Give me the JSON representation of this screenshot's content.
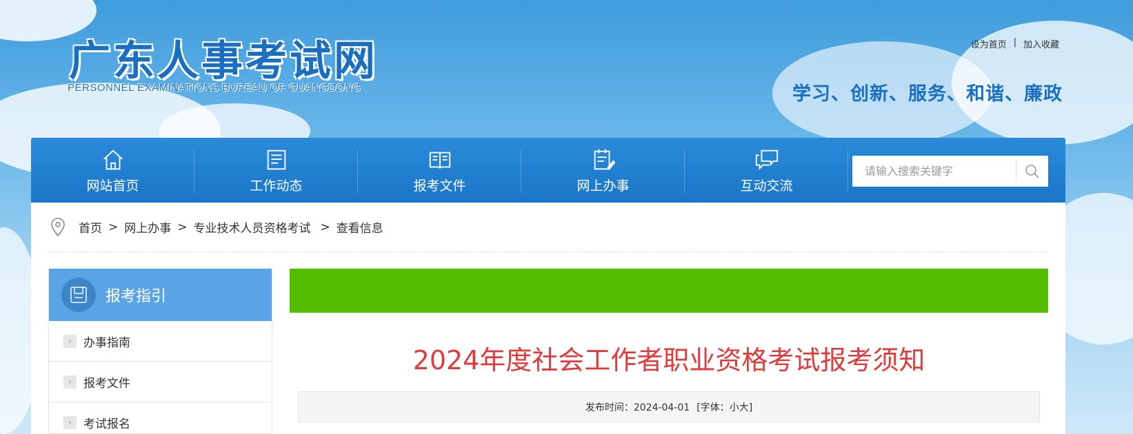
{
  "header": {
    "logo_cn": "广东人事考试网",
    "logo_en": "PERSONNEL EXAMINATIONS BUREAU OF GUANGDONG",
    "links": [
      "设为首页",
      "加入收藏"
    ],
    "link_sep": "|",
    "slogan": "学习、创新、服务、和谐、廉政"
  },
  "nav": {
    "items": [
      {
        "label": "网站首页",
        "icon": "home-icon"
      },
      {
        "label": "工作动态",
        "icon": "news-icon"
      },
      {
        "label": "报考文件",
        "icon": "book-icon"
      },
      {
        "label": "网上办事",
        "icon": "clipboard-icon"
      },
      {
        "label": "互动交流",
        "icon": "chat-icon"
      }
    ],
    "search_placeholder": "请输入搜索关键字"
  },
  "breadcrumb": {
    "items": [
      "首页",
      "网上办事",
      "专业技术人员资格考试",
      "查看信息"
    ],
    "sep": ">"
  },
  "sidebar": {
    "title": "报考指引",
    "items": [
      "办事指南",
      "报考文件",
      "考试报名"
    ],
    "arrow": "›"
  },
  "article": {
    "title": "2024年度社会工作者职业资格考试报考须知",
    "publish_label": "发布时间：2024-04-01",
    "font_prefix": "[字体：",
    "font_small": "小",
    "font_large": "大",
    "font_suffix": "]",
    "banner_color": "#55bd00",
    "title_color": "#e23a3a"
  }
}
